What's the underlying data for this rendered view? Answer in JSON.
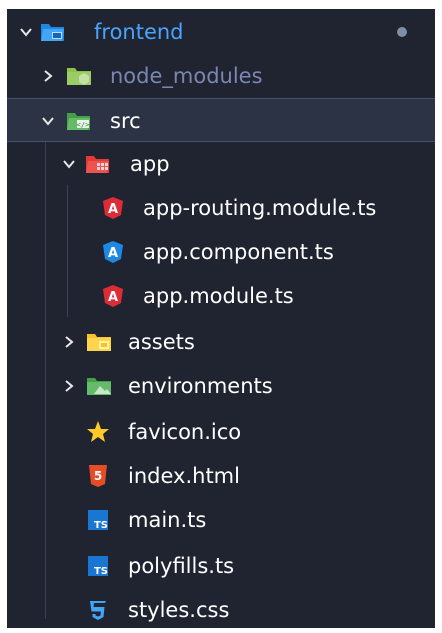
{
  "explorer": {
    "root": {
      "label": "frontend",
      "icon": "folder-client-open-icon",
      "expanded": true,
      "modified_indicator": true
    },
    "items": [
      {
        "label": "node_modules",
        "icon": "folder-node-icon",
        "type": "folder",
        "expanded": false,
        "depth": 1
      },
      {
        "label": "src",
        "icon": "folder-src-open-icon",
        "type": "folder",
        "expanded": true,
        "depth": 1,
        "selected": true
      },
      {
        "label": "app",
        "icon": "folder-app-open-icon",
        "type": "folder",
        "expanded": true,
        "depth": 2
      },
      {
        "label": "app-routing.module.ts",
        "icon": "angular-routing-icon",
        "type": "file",
        "depth": 3
      },
      {
        "label": "app.component.ts",
        "icon": "angular-component-icon",
        "type": "file",
        "depth": 3
      },
      {
        "label": "app.module.ts",
        "icon": "angular-module-icon",
        "type": "file",
        "depth": 3
      },
      {
        "label": "assets",
        "icon": "folder-assets-icon",
        "type": "folder",
        "expanded": false,
        "depth": 2
      },
      {
        "label": "environments",
        "icon": "folder-environment-icon",
        "type": "folder",
        "expanded": false,
        "depth": 2
      },
      {
        "label": "favicon.ico",
        "icon": "star-icon",
        "type": "file",
        "depth": 2
      },
      {
        "label": "index.html",
        "icon": "html5-icon",
        "type": "file",
        "depth": 2
      },
      {
        "label": "main.ts",
        "icon": "typescript-icon",
        "type": "file",
        "depth": 2
      },
      {
        "label": "polyfills.ts",
        "icon": "typescript-icon",
        "type": "file",
        "depth": 2
      },
      {
        "label": "styles.css",
        "icon": "css3-icon",
        "type": "file",
        "depth": 2
      }
    ]
  },
  "colors": {
    "background": "#1f2430",
    "selected_row": "#2c3344",
    "folder_label": "#4aa3ff",
    "muted_label": "#7b86b3",
    "angular_red": "#dd2c35",
    "angular_blue": "#1e88e5",
    "html_orange": "#e44d26",
    "ts_blue": "#1565c0",
    "css_blue": "#42a5f5",
    "star_yellow": "#ffca28"
  }
}
